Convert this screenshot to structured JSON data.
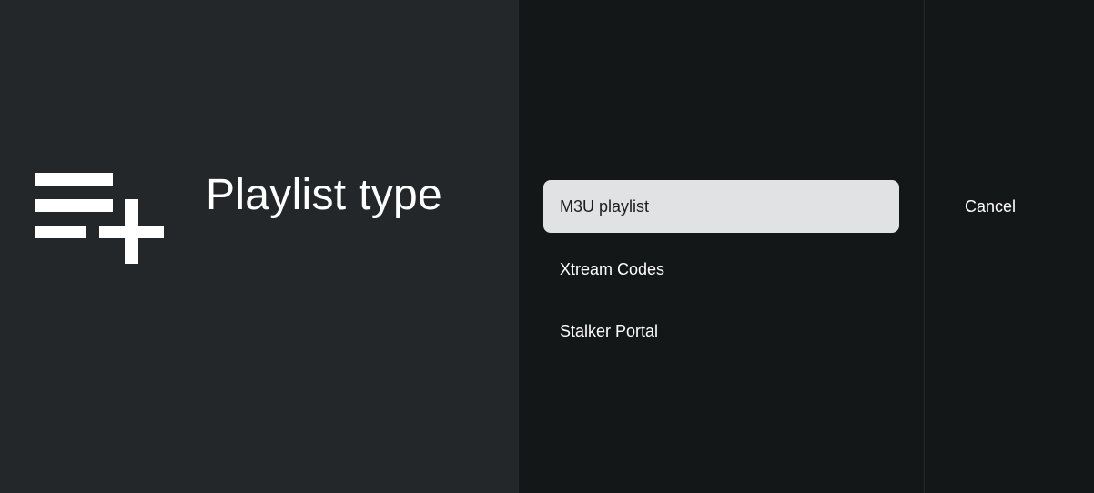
{
  "header": {
    "icon": "playlist-add-icon",
    "title": "Playlist type"
  },
  "options": {
    "items": [
      {
        "label": "M3U playlist",
        "selected": true
      },
      {
        "label": "Xtream Codes",
        "selected": false
      },
      {
        "label": "Stalker Portal",
        "selected": false
      }
    ]
  },
  "actions": {
    "cancel_label": "Cancel"
  },
  "colors": {
    "left_pane_bg": "#24272a",
    "right_bg": "#141718",
    "selected_bg": "#e0e2e4",
    "selected_text": "#1b1d1f",
    "text": "#ffffff"
  }
}
